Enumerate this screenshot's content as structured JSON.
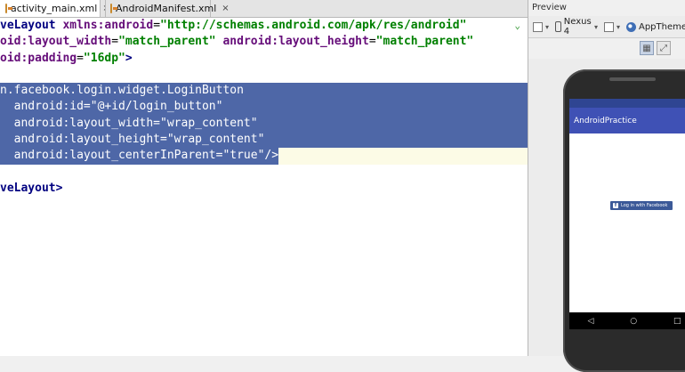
{
  "editor": {
    "tabs": [
      {
        "label": "activity_main.xml",
        "close": "×",
        "active": true
      },
      {
        "label": "AndroidManifest.xml",
        "close": "×",
        "active": false
      }
    ],
    "lines": [
      {
        "t": "veLayout",
        "a1": "xmlns:android",
        "v1": "\"http://schemas.android.com/apk/res/android\""
      },
      {
        "a1": "oid:layout_width",
        "v1": "\"match_parent\"",
        "a2": "android:layout_height",
        "v2": "\"match_parent\""
      },
      {
        "a1": "oid:padding",
        "v1": "\"16dp\"",
        "close": ">"
      },
      {},
      {
        "sel": "n.facebook.login.widget.LoginButton"
      },
      {
        "sel": "  android:id=\"@+id/login_button\""
      },
      {
        "sel": "  android:layout_width=\"wrap_content\""
      },
      {
        "sel": "  android:layout_height=\"wrap_content\""
      },
      {
        "sel": "  android:layout_centerInParent=\"true\"/>"
      },
      {},
      {
        "t": "veLayout",
        "close": ">"
      }
    ],
    "fold_marker": "⌄"
  },
  "preview": {
    "title": "Preview",
    "device": "Nexus 4",
    "theme": "AppTheme",
    "app_title": "AndroidPractice",
    "fb_button_label": "Log in with Facebook",
    "fb_glyph": "f",
    "nav": {
      "back": "◁",
      "home": "○",
      "recents": "□"
    }
  },
  "colors": {
    "selection": "#4e67a7",
    "action_bar": "#3f51b5",
    "status_bar": "#2f4592",
    "facebook_blue": "#3b5998",
    "xml_tag": "#000080",
    "xml_attr": "#660e7a",
    "xml_value": "#008000"
  }
}
